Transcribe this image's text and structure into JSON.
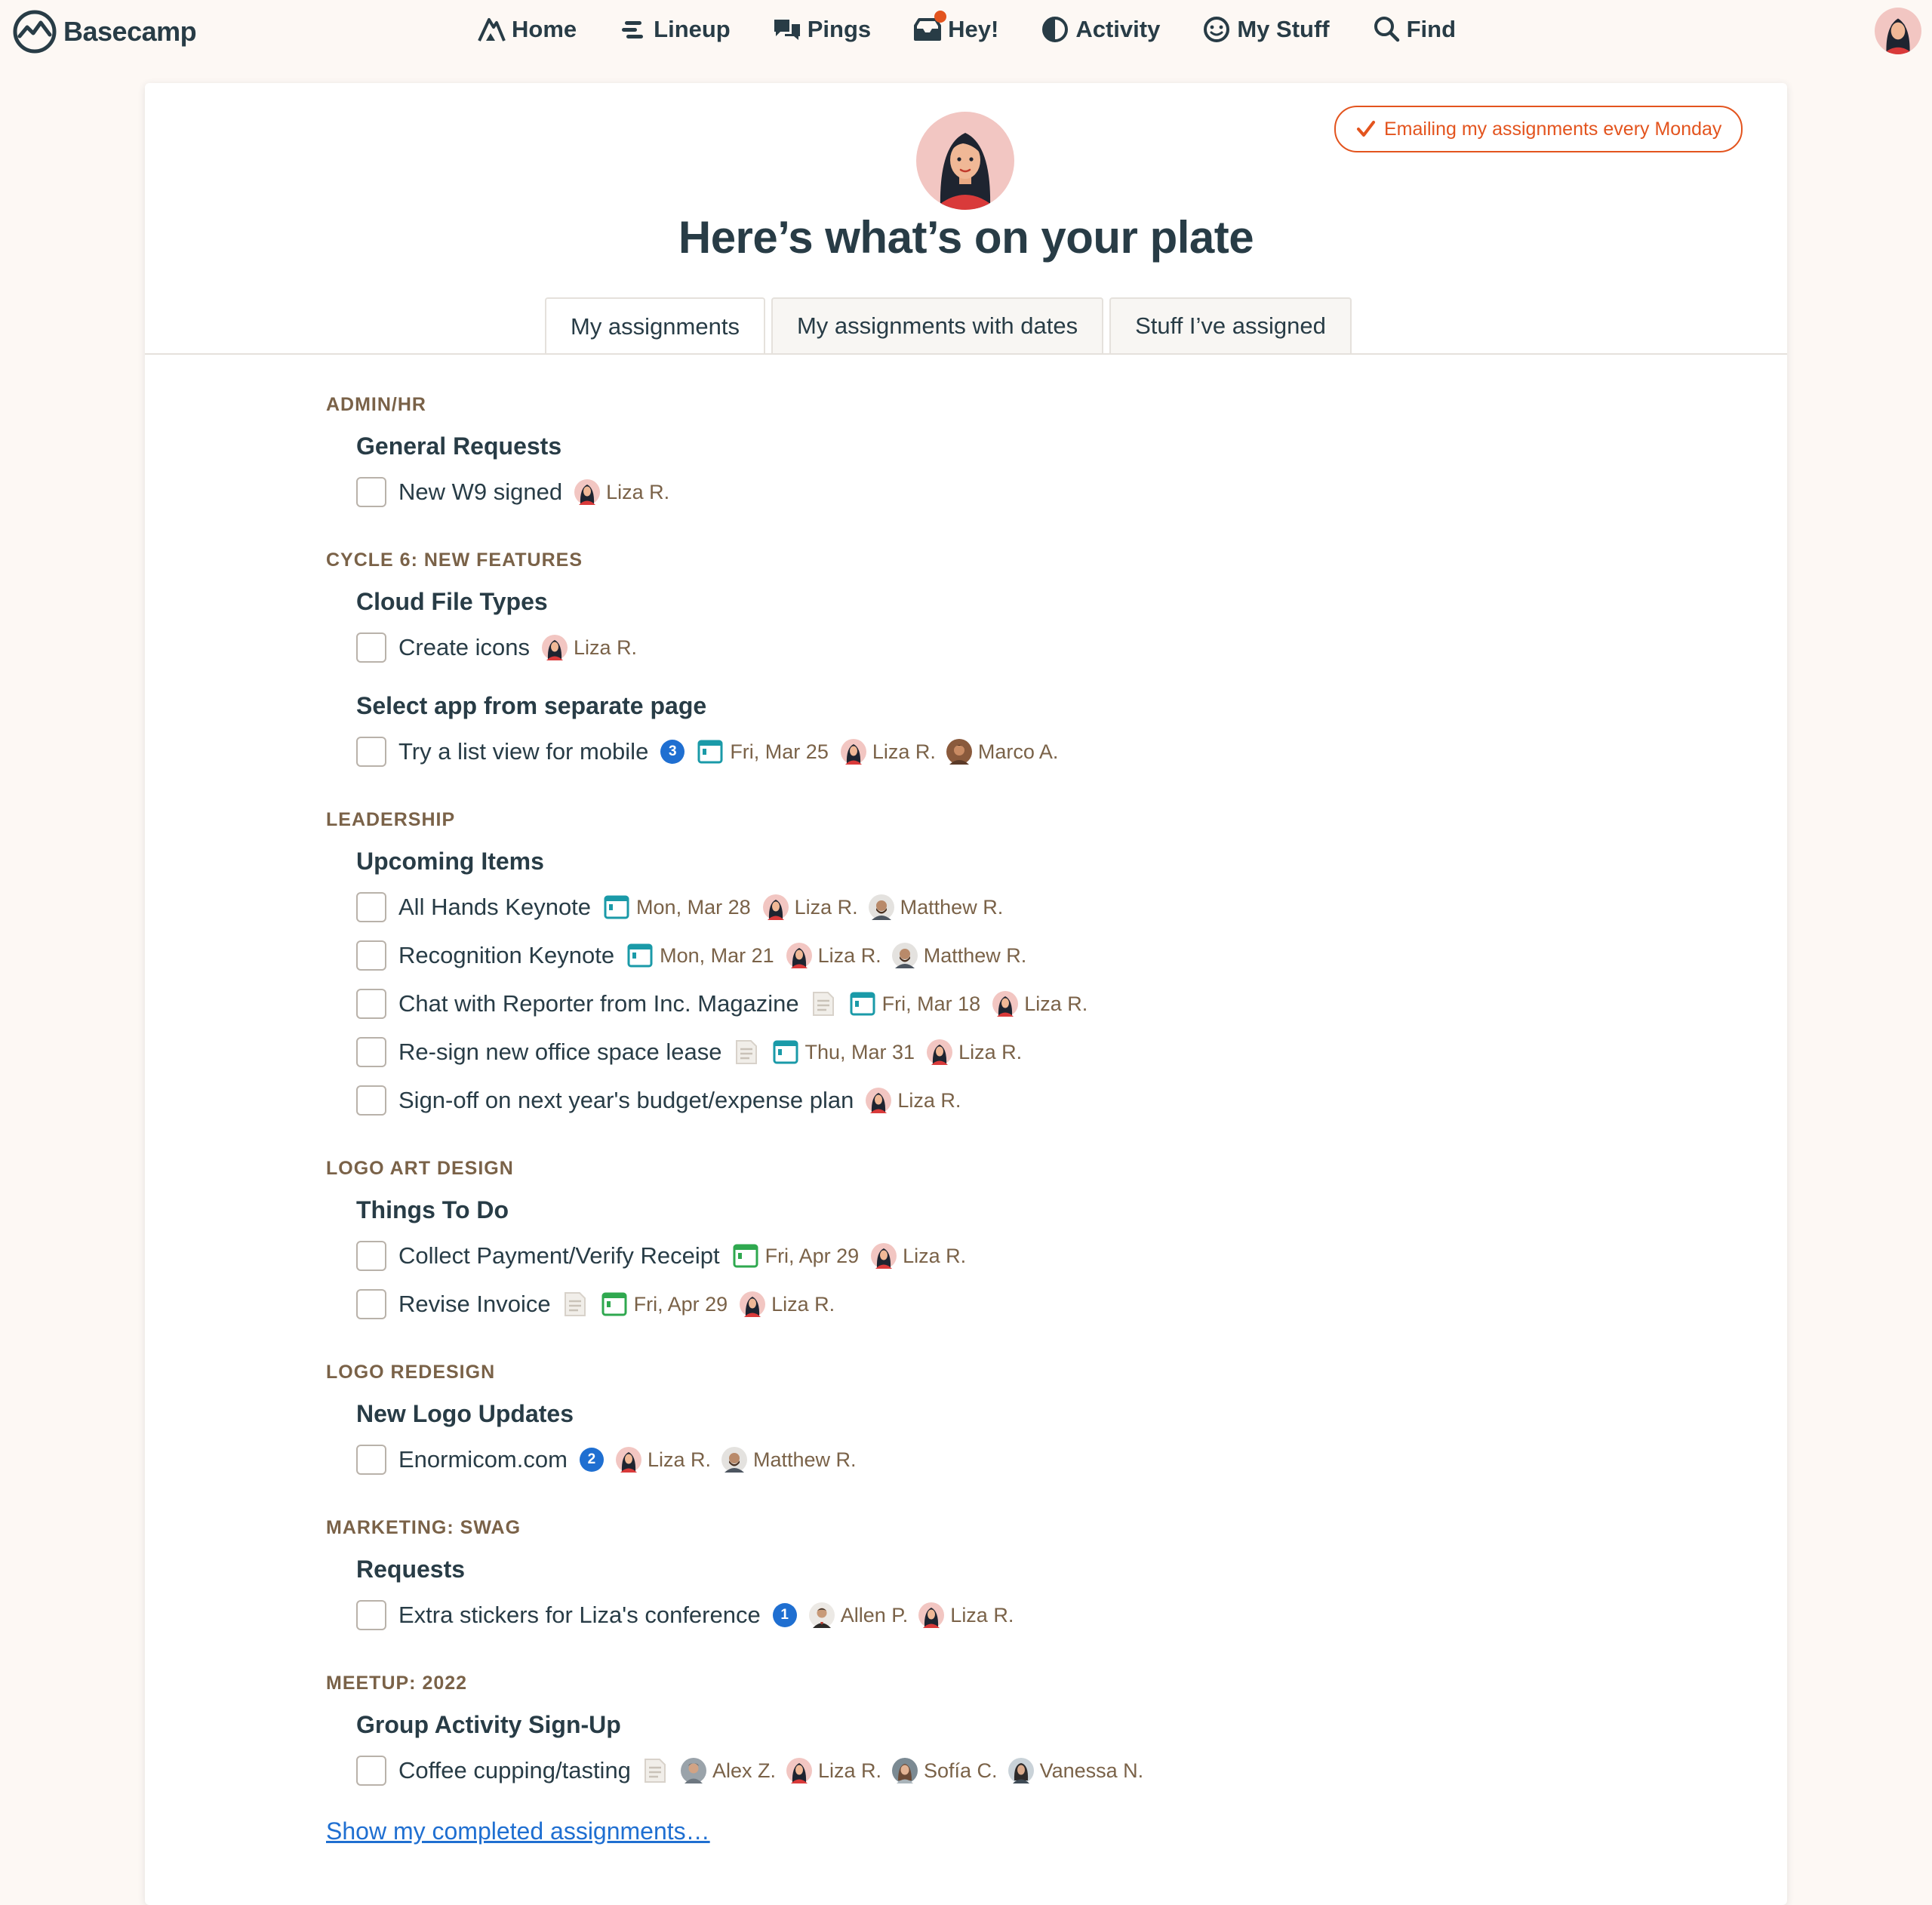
{
  "brand": {
    "name": "Basecamp"
  },
  "nav": {
    "items": [
      {
        "label": "Home",
        "icon": "home-icon"
      },
      {
        "label": "Lineup",
        "icon": "lineup-icon"
      },
      {
        "label": "Pings",
        "icon": "pings-icon"
      },
      {
        "label": "Hey!",
        "icon": "hey-inbox-icon"
      },
      {
        "label": "Activity",
        "icon": "activity-icon"
      },
      {
        "label": "My Stuff",
        "icon": "my-stuff-icon"
      },
      {
        "label": "Find",
        "icon": "search-icon"
      }
    ]
  },
  "header": {
    "email_button": "Emailing my assignments every Monday",
    "title": "Here’s what’s on your plate"
  },
  "tabs": [
    {
      "label": "My assignments",
      "active": true
    },
    {
      "label": "My assignments with dates",
      "active": false
    },
    {
      "label": "Stuff I’ve assigned",
      "active": false
    }
  ],
  "projects": [
    {
      "name": "ADMIN/HR",
      "lists": [
        {
          "name": "General Requests",
          "todos": [
            {
              "title": "New W9 signed",
              "people": [
                "Liza R."
              ]
            }
          ]
        }
      ]
    },
    {
      "name": "CYCLE 6: NEW FEATURES",
      "lists": [
        {
          "name": "Cloud File Types",
          "todos": [
            {
              "title": "Create icons",
              "people": [
                "Liza R."
              ]
            }
          ]
        },
        {
          "name": "Select app from separate page",
          "todos": [
            {
              "title": "Try a list view for mobile",
              "comments": "3",
              "date": "Fri, Mar 25",
              "people": [
                "Liza R.",
                "Marco A."
              ]
            }
          ]
        }
      ]
    },
    {
      "name": "LEADERSHIP",
      "lists": [
        {
          "name": "Upcoming Items",
          "todos": [
            {
              "title": "All Hands Keynote",
              "date": "Mon, Mar 28",
              "people": [
                "Liza R.",
                "Matthew R."
              ]
            },
            {
              "title": "Recognition Keynote",
              "date": "Mon, Mar 21",
              "people": [
                "Liza R.",
                "Matthew R."
              ]
            },
            {
              "title": "Chat with Reporter from Inc. Magazine",
              "note": true,
              "date": "Fri, Mar 18",
              "people": [
                "Liza R."
              ]
            },
            {
              "title": "Re-sign new office space lease",
              "note": true,
              "date": "Thu, Mar 31",
              "people": [
                "Liza R."
              ]
            },
            {
              "title": "Sign-off on next year's budget/expense plan",
              "people": [
                "Liza R."
              ]
            }
          ]
        }
      ]
    },
    {
      "name": "LOGO ART DESIGN",
      "lists": [
        {
          "name": "Things To Do",
          "todos": [
            {
              "title": "Collect Payment/Verify Receipt",
              "date": "Fri, Apr 29",
              "people": [
                "Liza R."
              ]
            },
            {
              "title": "Revise Invoice",
              "note": true,
              "date": "Fri, Apr 29",
              "people": [
                "Liza R."
              ]
            }
          ]
        }
      ]
    },
    {
      "name": "LOGO REDESIGN",
      "lists": [
        {
          "name": "New Logo Updates",
          "todos": [
            {
              "title": "Enormicom.com",
              "comments": "2",
              "people": [
                "Liza R.",
                "Matthew R."
              ]
            }
          ]
        }
      ]
    },
    {
      "name": "MARKETING: SWAG",
      "lists": [
        {
          "name": "Requests",
          "todos": [
            {
              "title": "Extra stickers for Liza's conference",
              "comments": "1",
              "people": [
                "Allen P.",
                "Liza R."
              ]
            }
          ]
        }
      ]
    },
    {
      "name": "MEETUP: 2022",
      "lists": [
        {
          "name": "Group Activity Sign-Up",
          "todos": [
            {
              "title": "Coffee cupping/tasting",
              "note": true,
              "people": [
                "Alex Z.",
                "Liza R.",
                "Sofía C.",
                "Vanessa N."
              ]
            }
          ]
        }
      ]
    }
  ],
  "footer": {
    "show_completed": "Show my completed assignments…"
  },
  "colors": {
    "accent": "#e3541e",
    "text": "#283c46",
    "meta": "#7a6248",
    "link": "#1f6fd1",
    "calendar_teal": "#1a9aa8",
    "calendar_green": "#2fa84f",
    "background": "#fdf8f4"
  }
}
